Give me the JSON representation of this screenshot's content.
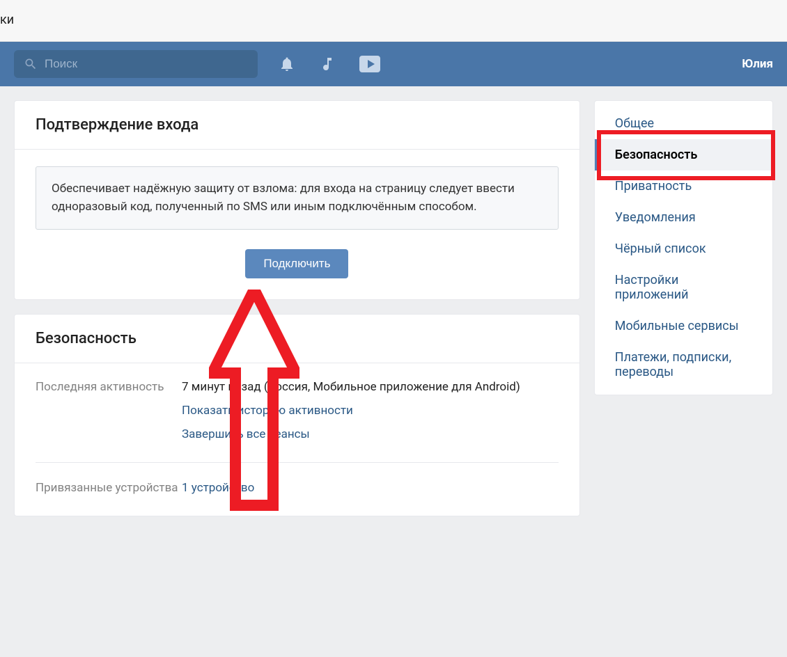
{
  "top_fragment": "ки",
  "header": {
    "search_placeholder": "Поиск",
    "user_name": "Юлия"
  },
  "sidebar": {
    "items": [
      {
        "label": "Общее"
      },
      {
        "label": "Безопасность"
      },
      {
        "label": "Приватность"
      },
      {
        "label": "Уведомления"
      },
      {
        "label": "Чёрный список"
      },
      {
        "label": "Настройки приложений"
      },
      {
        "label": "Мобильные сервисы"
      },
      {
        "label": "Платежи, подписки, переводы"
      }
    ],
    "active_index": 1
  },
  "confirm_block": {
    "title": "Подтверждение входа",
    "info_text": "Обеспечивает надёжную защиту от взлома: для входа на страницу следует ввести одноразовый код, полученный по SMS или иным подключённым способом.",
    "button_label": "Подключить"
  },
  "security_block": {
    "title": "Безопасность",
    "rows": {
      "last_activity_label": "Последняя активность",
      "last_activity_value": "7 минут назад (Россия, Мобильное приложение для Android)",
      "show_history_link": "Показать историю активности",
      "end_sessions_link": "Завершить все сеансы",
      "devices_label": "Привязанные устройства",
      "devices_value": "1 устройство"
    }
  }
}
